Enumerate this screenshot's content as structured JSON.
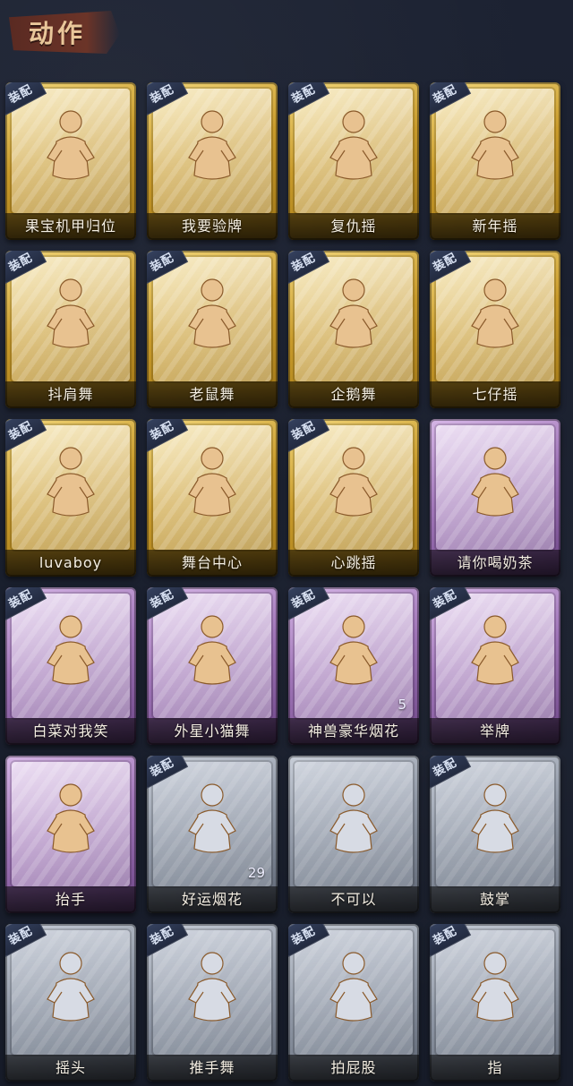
{
  "header": {
    "title": "动作"
  },
  "equip_badge": "装配",
  "colors": {
    "gold": "#c89a2a",
    "purple": "#9f74b7",
    "silver": "#8f97a5",
    "figure_gold": "#e8c290",
    "figure_silver": "#d7dbe4"
  },
  "cards": [
    {
      "label": "果宝机甲归位",
      "tier": "gold",
      "equipped": true,
      "icon": "character-dance-icon"
    },
    {
      "label": "我要验牌",
      "tier": "gold",
      "equipped": true,
      "icon": "character-card-icon"
    },
    {
      "label": "复仇摇",
      "tier": "gold",
      "equipped": true,
      "icon": "character-point-up-icon"
    },
    {
      "label": "新年摇",
      "tier": "gold",
      "equipped": true,
      "icon": "character-clap-icon"
    },
    {
      "label": "抖肩舞",
      "tier": "gold",
      "equipped": true,
      "icon": "character-shoulder-icon"
    },
    {
      "label": "老鼠舞",
      "tier": "gold",
      "equipped": true,
      "icon": "character-mouse-icon"
    },
    {
      "label": "企鹅舞",
      "tier": "gold",
      "equipped": true,
      "icon": "character-penguin-icon"
    },
    {
      "label": "七仔摇",
      "tier": "gold",
      "equipped": true,
      "icon": "character-arms-icon"
    },
    {
      "label": "luvaboy",
      "tier": "gold",
      "equipped": true,
      "icon": "character-hug-icon"
    },
    {
      "label": "舞台中心",
      "tier": "gold",
      "equipped": true,
      "icon": "character-stage-icon"
    },
    {
      "label": "心跳摇",
      "tier": "gold",
      "equipped": true,
      "icon": "character-wave-icon"
    },
    {
      "label": "请你喝奶茶",
      "tier": "purple",
      "equipped": false,
      "icon": "character-tea-icon"
    },
    {
      "label": "白菜对我笑",
      "tier": "purple",
      "equipped": true,
      "icon": "character-cross-arms-icon"
    },
    {
      "label": "外星小猫舞",
      "tier": "purple",
      "equipped": true,
      "icon": "character-cat-dance-icon"
    },
    {
      "label": "神兽豪华烟花",
      "tier": "purple",
      "equipped": true,
      "icon": "fireworks-icon",
      "count": "5"
    },
    {
      "label": "举牌",
      "tier": "purple",
      "equipped": true,
      "icon": "sign-board-icon"
    },
    {
      "label": "抬手",
      "tier": "purple",
      "equipped": false,
      "icon": "character-raise-hand-icon"
    },
    {
      "label": "好运烟花",
      "tier": "silver",
      "equipped": true,
      "icon": "firework-can-icon",
      "count": "29"
    },
    {
      "label": "不可以",
      "tier": "silver",
      "equipped": false,
      "icon": "finger-no-icon"
    },
    {
      "label": "鼓掌",
      "tier": "silver",
      "equipped": true,
      "icon": "clap-hands-icon"
    },
    {
      "label": "摇头",
      "tier": "silver",
      "equipped": true,
      "icon": "character-shake-head-icon"
    },
    {
      "label": "推手舞",
      "tier": "silver",
      "equipped": true,
      "icon": "character-push-icon"
    },
    {
      "label": "拍屁股",
      "tier": "silver",
      "equipped": true,
      "icon": "character-pat-icon"
    },
    {
      "label": "指",
      "tier": "silver",
      "equipped": true,
      "icon": "hand-point-icon"
    }
  ]
}
